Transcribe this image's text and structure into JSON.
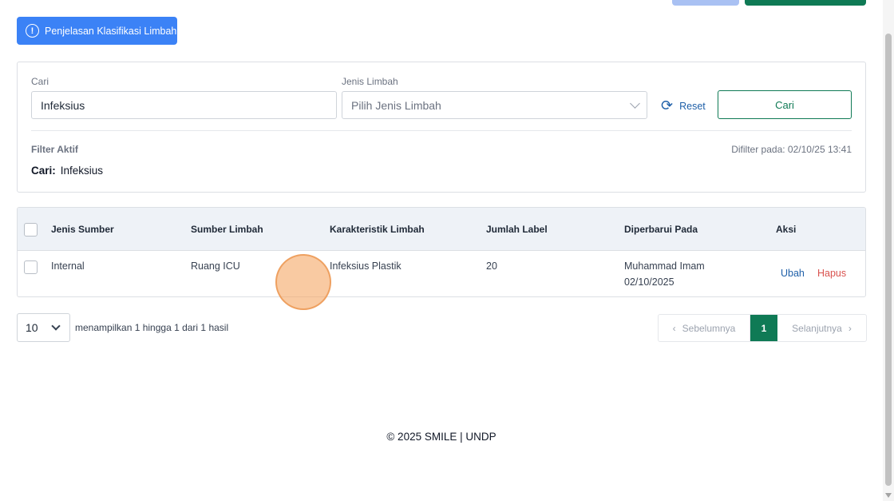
{
  "header": {
    "info_button_label": "Penjelasan Klasifikasi Limbah"
  },
  "filter": {
    "search_label": "Cari",
    "search_value": "Infeksius",
    "type_label": "Jenis Limbah",
    "type_placeholder": "Pilih Jenis Limbah",
    "reset_label": "Reset",
    "search_button_label": "Cari",
    "active_title": "Filter Aktif",
    "filtered_at": "Difilter pada: 02/10/25 13:41",
    "active_key": "Cari:",
    "active_value": "Infeksius"
  },
  "table": {
    "columns": [
      "Jenis Sumber",
      "Sumber Limbah",
      "Karakteristik Limbah",
      "Jumlah Label",
      "Diperbarui Pada",
      "Aksi"
    ],
    "rows": [
      {
        "source_type": "Internal",
        "source": "Ruang ICU",
        "characteristic": "Infeksius Plastik",
        "label_count": "20",
        "updated_by": "Muhammad Imam",
        "updated_date": "02/10/2025",
        "edit_label": "Ubah",
        "delete_label": "Hapus"
      }
    ]
  },
  "pagination": {
    "per_page": "10",
    "showing_text": "menampilkan 1 hingga 1 dari 1 hasil",
    "prev_label": "Sebelumnya",
    "current_page": "1",
    "next_label": "Selanjutnya"
  },
  "footer": {
    "text": "© 2025 SMILE | UNDP"
  },
  "colors": {
    "primary_blue": "#3b82f6",
    "brand_green": "#0f7a55",
    "danger": "#d9534f"
  }
}
